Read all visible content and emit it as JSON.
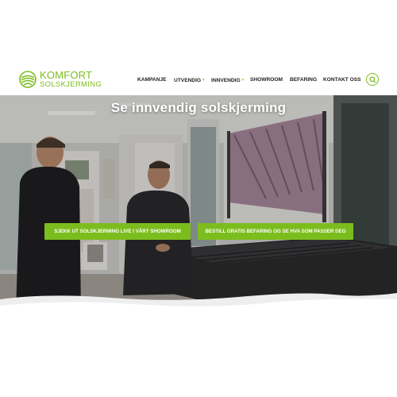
{
  "brand": {
    "name_top": "KOMFORT",
    "name_bottom": "SOLSKJERMING",
    "color": "#7cbd1e"
  },
  "nav": {
    "items": [
      {
        "label": "KAMPANJE",
        "has_dropdown": false
      },
      {
        "label": "UTVENDIG",
        "has_dropdown": true
      },
      {
        "label": "INNVENDIG",
        "has_dropdown": true
      },
      {
        "label": "SHOWROOM",
        "has_dropdown": false
      },
      {
        "label": "BEFARING",
        "has_dropdown": false
      },
      {
        "label": "KONTAKT OSS",
        "has_dropdown": false
      }
    ],
    "caret_glyph": "▾",
    "search_icon": "search-icon"
  },
  "hero": {
    "title": "Se innvendig solskjerming",
    "buttons": [
      {
        "label": "SJEKK UT SOLSKJERMING LIVE I VÅRT SHOWROOM"
      },
      {
        "label": "BESTILL GRATIS BEFARING OG SE HVA SOM PASSER DEG"
      }
    ]
  },
  "colors": {
    "accent": "#7cbd1e",
    "text_dark": "#222222",
    "white": "#ffffff"
  }
}
